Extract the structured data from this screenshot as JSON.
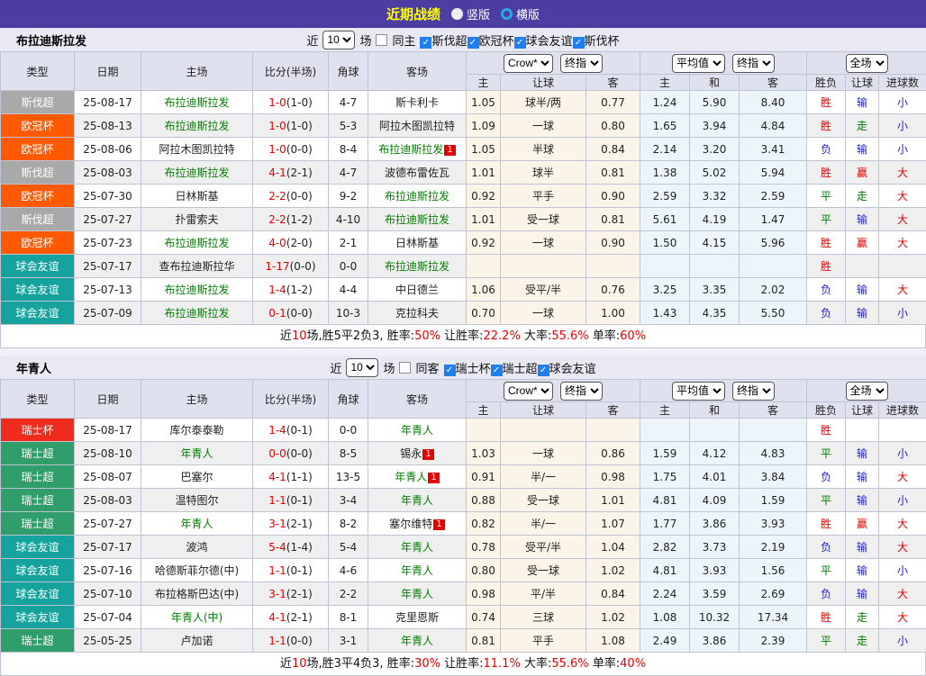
{
  "title_bar": {
    "title": "近期战绩",
    "radio_vertical": "竖版",
    "radio_horizontal": "横版",
    "selected_layout": "横版"
  },
  "filters": {
    "near": "近",
    "count": "10",
    "games": "场"
  },
  "header_selects": {
    "source": "Crow*",
    "final1": "终指",
    "average": "平均值",
    "final2": "终指",
    "full": "全场"
  },
  "columns": {
    "type": "类型",
    "date": "日期",
    "home": "主场",
    "score": "比分(半场)",
    "corner": "角球",
    "away": "客场",
    "home_odds": "主",
    "handicap": "让球",
    "away_odds": "客",
    "avg_home": "主",
    "avg_draw": "和",
    "avg_away": "客",
    "result": "胜负",
    "handicap_result": "让球",
    "goals": "进球数"
  },
  "colors": {
    "bar": "#4c3da2",
    "title": "#ffff00",
    "band": "#e9e9f3",
    "header_bg": "#dfe2ee",
    "stripe": "#efefef",
    "cream": "#fbf4e8",
    "lightblue": "#ecf5f9",
    "focus_team": "#008000",
    "score_red": "#e60000",
    "checkbox_blue": "#1f7ff0",
    "radio_blue": "#27a7e8",
    "league": {
      "斯伐超": "#a9a9a9",
      "欧冠杯": "#ff5a00",
      "球会友谊": "#17a39d",
      "斯伐杯": "#ee2b1c",
      "瑞士杯": "#ee2b1c",
      "瑞士超": "#2f9e6b"
    },
    "outcome": {
      "胜": "#e60000",
      "平": "#007a00",
      "负": "#2222cc",
      "赢": "#e60000",
      "走": "#007a00",
      "输": "#2222cc",
      "大": "#e60000",
      "小": "#2222cc"
    }
  },
  "sections": [
    {
      "team": "布拉迪斯拉发",
      "same_label": "同主",
      "leagues": [
        "斯伐超",
        "欧冠杯",
        "球会友谊",
        "斯伐杯"
      ],
      "rows": [
        {
          "league": "斯伐超",
          "date": "25-08-17",
          "home": "布拉迪斯拉发",
          "home_focus": true,
          "home_rc": "",
          "ft": "1-0",
          "ht": "(1-0)",
          "corner": "4-7",
          "away": "斯卡利卡",
          "away_focus": false,
          "away_rc": "",
          "odds": [
            "1.05",
            "球半/两",
            "0.77"
          ],
          "avg": [
            "1.24",
            "5.90",
            "8.40"
          ],
          "results": [
            "胜",
            "输",
            "小"
          ]
        },
        {
          "league": "欧冠杯",
          "date": "25-08-13",
          "home": "布拉迪斯拉发",
          "home_focus": true,
          "home_rc": "",
          "ft": "1-0",
          "ht": "(1-0)",
          "corner": "5-3",
          "away": "阿拉木图凯拉特",
          "away_focus": false,
          "away_rc": "",
          "odds": [
            "1.09",
            "一球",
            "0.80"
          ],
          "avg": [
            "1.65",
            "3.94",
            "4.84"
          ],
          "results": [
            "胜",
            "走",
            "小"
          ]
        },
        {
          "league": "欧冠杯",
          "date": "25-08-06",
          "home": "阿拉木图凯拉特",
          "home_focus": false,
          "home_rc": "",
          "ft": "1-0",
          "ht": "(0-0)",
          "corner": "8-4",
          "away": "布拉迪斯拉发",
          "away_focus": true,
          "away_rc": "1",
          "odds": [
            "1.05",
            "半球",
            "0.84"
          ],
          "avg": [
            "2.14",
            "3.20",
            "3.41"
          ],
          "results": [
            "负",
            "输",
            "小"
          ]
        },
        {
          "league": "斯伐超",
          "date": "25-08-03",
          "home": "布拉迪斯拉发",
          "home_focus": true,
          "home_rc": "",
          "ft": "4-1",
          "ht": "(2-1)",
          "corner": "4-7",
          "away": "波德布雷佐瓦",
          "away_focus": false,
          "away_rc": "",
          "odds": [
            "1.01",
            "球半",
            "0.81"
          ],
          "avg": [
            "1.38",
            "5.02",
            "5.94"
          ],
          "results": [
            "胜",
            "赢",
            "大"
          ]
        },
        {
          "league": "欧冠杯",
          "date": "25-07-30",
          "home": "日林斯基",
          "home_focus": false,
          "home_rc": "",
          "ft": "2-2",
          "ht": "(0-0)",
          "corner": "9-2",
          "away": "布拉迪斯拉发",
          "away_focus": true,
          "away_rc": "",
          "odds": [
            "0.92",
            "平手",
            "0.90"
          ],
          "avg": [
            "2.59",
            "3.32",
            "2.59"
          ],
          "results": [
            "平",
            "走",
            "大"
          ]
        },
        {
          "league": "斯伐超",
          "date": "25-07-27",
          "home": "扑雷索夫",
          "home_focus": false,
          "home_rc": "",
          "ft": "2-2",
          "ht": "(1-2)",
          "corner": "4-10",
          "away": "布拉迪斯拉发",
          "away_focus": true,
          "away_rc": "",
          "odds": [
            "1.01",
            "受一球",
            "0.81"
          ],
          "avg": [
            "5.61",
            "4.19",
            "1.47"
          ],
          "results": [
            "平",
            "输",
            "大"
          ]
        },
        {
          "league": "欧冠杯",
          "date": "25-07-23",
          "home": "布拉迪斯拉发",
          "home_focus": true,
          "home_rc": "",
          "ft": "4-0",
          "ht": "(2-0)",
          "corner": "2-1",
          "away": "日林斯基",
          "away_focus": false,
          "away_rc": "",
          "odds": [
            "0.92",
            "一球",
            "0.90"
          ],
          "avg": [
            "1.50",
            "4.15",
            "5.96"
          ],
          "results": [
            "胜",
            "赢",
            "大"
          ]
        },
        {
          "league": "球会友谊",
          "date": "25-07-17",
          "home": "查布拉迪斯拉华",
          "home_focus": false,
          "home_rc": "",
          "ft": "1-17",
          "ht": "(0-0)",
          "corner": "0-0",
          "away": "布拉迪斯拉发",
          "away_focus": true,
          "away_rc": "",
          "odds": [
            "",
            "",
            ""
          ],
          "avg": [
            "",
            "",
            ""
          ],
          "results": [
            "胜",
            "",
            ""
          ]
        },
        {
          "league": "球会友谊",
          "date": "25-07-13",
          "home": "布拉迪斯拉发",
          "home_focus": true,
          "home_rc": "",
          "ft": "1-4",
          "ht": "(1-2)",
          "corner": "4-4",
          "away": "中日德兰",
          "away_focus": false,
          "away_rc": "",
          "odds": [
            "1.06",
            "受平/半",
            "0.76"
          ],
          "avg": [
            "3.25",
            "3.35",
            "2.02"
          ],
          "results": [
            "负",
            "输",
            "大"
          ]
        },
        {
          "league": "球会友谊",
          "date": "25-07-09",
          "home": "布拉迪斯拉发",
          "home_focus": true,
          "home_rc": "",
          "ft": "0-1",
          "ht": "(0-0)",
          "corner": "10-3",
          "away": "克拉科夫",
          "away_focus": false,
          "away_rc": "",
          "odds": [
            "0.70",
            "一球",
            "1.00"
          ],
          "avg": [
            "1.43",
            "4.35",
            "5.50"
          ],
          "results": [
            "负",
            "输",
            "小"
          ]
        }
      ],
      "summary": [
        {
          "t": "近",
          "r": false
        },
        {
          "t": "10",
          "r": true
        },
        {
          "t": "场,胜5平2负3, 胜率:",
          "r": false
        },
        {
          "t": "50%",
          "r": true
        },
        {
          "t": " 让胜率:",
          "r": false
        },
        {
          "t": "22.2%",
          "r": true
        },
        {
          "t": " 大率:",
          "r": false
        },
        {
          "t": "55.6%",
          "r": true
        },
        {
          "t": " 单率:",
          "r": false
        },
        {
          "t": "60%",
          "r": true
        }
      ]
    },
    {
      "team": "年青人",
      "same_label": "同客",
      "leagues": [
        "瑞士杯",
        "瑞士超",
        "球会友谊"
      ],
      "rows": [
        {
          "league": "瑞士杯",
          "date": "25-08-17",
          "home": "库尔泰泰勒",
          "home_focus": false,
          "home_rc": "",
          "ft": "1-4",
          "ht": "(0-1)",
          "corner": "0-0",
          "away": "年青人",
          "away_focus": true,
          "away_rc": "",
          "odds": [
            "",
            "",
            ""
          ],
          "avg": [
            "",
            "",
            ""
          ],
          "results": [
            "胜",
            "",
            ""
          ]
        },
        {
          "league": "瑞士超",
          "date": "25-08-10",
          "home": "年青人",
          "home_focus": true,
          "home_rc": "",
          "ft": "0-0",
          "ht": "(0-0)",
          "corner": "8-5",
          "away": "锡永",
          "away_focus": false,
          "away_rc": "1",
          "odds": [
            "1.03",
            "一球",
            "0.86"
          ],
          "avg": [
            "1.59",
            "4.12",
            "4.83"
          ],
          "results": [
            "平",
            "输",
            "小"
          ]
        },
        {
          "league": "瑞士超",
          "date": "25-08-07",
          "home": "巴塞尔",
          "home_focus": false,
          "home_rc": "",
          "ft": "4-1",
          "ht": "(1-1)",
          "corner": "13-5",
          "away": "年青人",
          "away_focus": true,
          "away_rc": "1",
          "odds": [
            "0.91",
            "半/一",
            "0.98"
          ],
          "avg": [
            "1.75",
            "4.01",
            "3.84"
          ],
          "results": [
            "负",
            "输",
            "大"
          ]
        },
        {
          "league": "瑞士超",
          "date": "25-08-03",
          "home": "温特图尔",
          "home_focus": false,
          "home_rc": "",
          "ft": "1-1",
          "ht": "(0-1)",
          "corner": "3-4",
          "away": "年青人",
          "away_focus": true,
          "away_rc": "",
          "odds": [
            "0.88",
            "受一球",
            "1.01"
          ],
          "avg": [
            "4.81",
            "4.09",
            "1.59"
          ],
          "results": [
            "平",
            "输",
            "小"
          ]
        },
        {
          "league": "瑞士超",
          "date": "25-07-27",
          "home": "年青人",
          "home_focus": true,
          "home_rc": "",
          "ft": "3-1",
          "ht": "(2-1)",
          "corner": "8-2",
          "away": "塞尔维特",
          "away_focus": false,
          "away_rc": "1",
          "odds": [
            "0.82",
            "半/一",
            "1.07"
          ],
          "avg": [
            "1.77",
            "3.86",
            "3.93"
          ],
          "results": [
            "胜",
            "赢",
            "大"
          ]
        },
        {
          "league": "球会友谊",
          "date": "25-07-17",
          "home": "波鸿",
          "home_focus": false,
          "home_rc": "",
          "ft": "5-4",
          "ht": "(1-4)",
          "corner": "5-4",
          "away": "年青人",
          "away_focus": true,
          "away_rc": "",
          "odds": [
            "0.78",
            "受平/半",
            "1.04"
          ],
          "avg": [
            "2.82",
            "3.73",
            "2.19"
          ],
          "results": [
            "负",
            "输",
            "大"
          ]
        },
        {
          "league": "球会友谊",
          "date": "25-07-16",
          "home": "哈德斯菲尔德(中)",
          "home_focus": false,
          "home_rc": "",
          "ft": "1-1",
          "ht": "(0-1)",
          "corner": "4-6",
          "away": "年青人",
          "away_focus": true,
          "away_rc": "",
          "odds": [
            "0.80",
            "受一球",
            "1.02"
          ],
          "avg": [
            "4.81",
            "3.93",
            "1.56"
          ],
          "results": [
            "平",
            "输",
            "小"
          ]
        },
        {
          "league": "球会友谊",
          "date": "25-07-10",
          "home": "布拉格斯巴达(中)",
          "home_focus": false,
          "home_rc": "",
          "ft": "3-1",
          "ht": "(2-1)",
          "corner": "2-2",
          "away": "年青人",
          "away_focus": true,
          "away_rc": "",
          "odds": [
            "0.98",
            "平/半",
            "0.84"
          ],
          "avg": [
            "2.24",
            "3.59",
            "2.69"
          ],
          "results": [
            "负",
            "输",
            "大"
          ]
        },
        {
          "league": "球会友谊",
          "date": "25-07-04",
          "home": "年青人(中)",
          "home_focus": true,
          "home_rc": "",
          "ft": "4-1",
          "ht": "(2-1)",
          "corner": "8-1",
          "away": "克里恩斯",
          "away_focus": false,
          "away_rc": "",
          "odds": [
            "0.74",
            "三球",
            "1.02"
          ],
          "avg": [
            "1.08",
            "10.32",
            "17.34"
          ],
          "results": [
            "胜",
            "走",
            "大"
          ]
        },
        {
          "league": "瑞士超",
          "date": "25-05-25",
          "home": "卢加诺",
          "home_focus": false,
          "home_rc": "",
          "ft": "1-1",
          "ht": "(0-0)",
          "corner": "3-1",
          "away": "年青人",
          "away_focus": true,
          "away_rc": "",
          "odds": [
            "0.81",
            "平手",
            "1.08"
          ],
          "avg": [
            "2.49",
            "3.86",
            "2.39"
          ],
          "results": [
            "平",
            "走",
            "小"
          ]
        }
      ],
      "summary": [
        {
          "t": "近",
          "r": false
        },
        {
          "t": "10",
          "r": true
        },
        {
          "t": "场,胜3平4负3, 胜率:",
          "r": false
        },
        {
          "t": "30%",
          "r": true
        },
        {
          "t": " 让胜率:",
          "r": false
        },
        {
          "t": "11.1%",
          "r": true
        },
        {
          "t": " 大率:",
          "r": false
        },
        {
          "t": "55.6%",
          "r": true
        },
        {
          "t": " 单率:",
          "r": false
        },
        {
          "t": "40%",
          "r": true
        }
      ]
    }
  ]
}
